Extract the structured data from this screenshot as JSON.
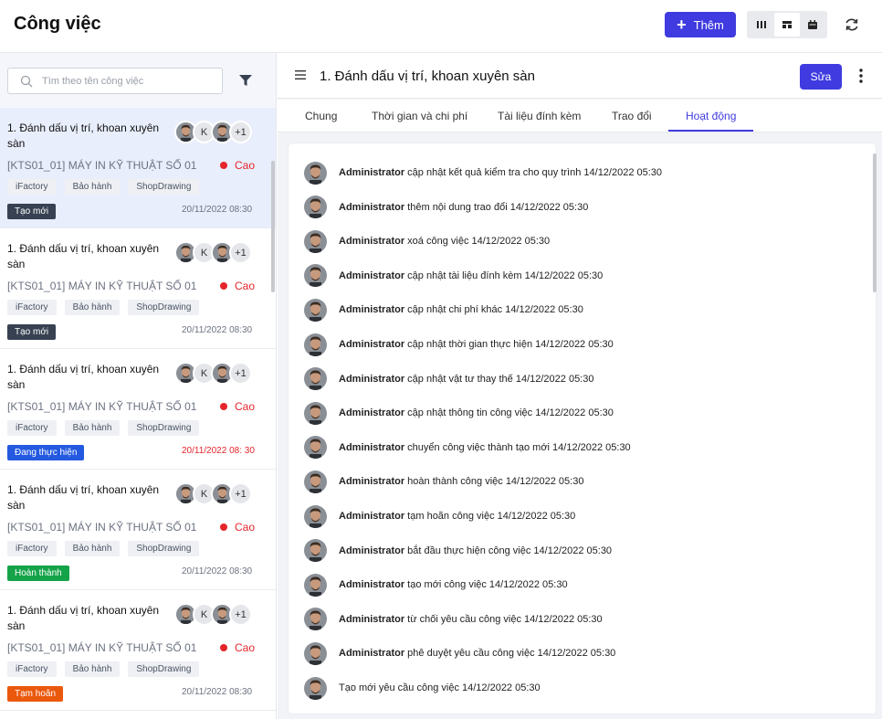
{
  "header": {
    "title": "Công việc",
    "add_label": "Thêm",
    "accent": "#3f3be0"
  },
  "search": {
    "placeholder": "Tìm theo tên công việc"
  },
  "cards": [
    {
      "title": "1. Đánh dấu vị trí, khoan xuyên sàn",
      "k": "K",
      "more": "+1",
      "code": "[KTS01_01] MÁY IN KỸ THUẬT SỐ 01",
      "priority": "Cao",
      "tags": [
        "iFactory",
        "Bảo hành",
        "ShopDrawing"
      ],
      "status": "Tạo mới",
      "status_color": "#374151",
      "date": "20/11/2022 08:30",
      "selected": true
    },
    {
      "title": "1. Đánh dấu vị trí, khoan xuyên sàn",
      "k": "K",
      "more": "+1",
      "code": "[KTS01_01] MÁY IN KỸ THUẬT SỐ 01",
      "priority": "Cao",
      "tags": [
        "iFactory",
        "Bảo hành",
        "ShopDrawing"
      ],
      "status": "Tạo mới",
      "status_color": "#374151",
      "date": "20/11/2022 08:30"
    },
    {
      "title": "1. Đánh dấu vị trí, khoan xuyên sàn",
      "k": "K",
      "more": "+1",
      "code": "[KTS01_01] MÁY IN KỸ THUẬT SỐ 01",
      "priority": "Cao",
      "tags": [
        "iFactory",
        "Bảo hành",
        "ShopDrawing"
      ],
      "status": "Đang thực hiện",
      "status_color": "#2459e0",
      "date": "20/11/2022 08: 30",
      "date_red": true
    },
    {
      "title": "1. Đánh dấu vị trí, khoan xuyên sàn",
      "k": "K",
      "more": "+1",
      "code": "[KTS01_01] MÁY IN KỸ THUẬT SỐ 01",
      "priority": "Cao",
      "tags": [
        "iFactory",
        "Bảo hành",
        "ShopDrawing"
      ],
      "status": "Hoàn thành",
      "status_color": "#15a34a",
      "date": "20/11/2022 08:30"
    },
    {
      "title": "1. Đánh dấu vị trí, khoan xuyên sàn",
      "k": "K",
      "more": "+1",
      "code": "[KTS01_01] MÁY IN KỸ THUẬT SỐ 01",
      "priority": "Cao",
      "tags": [
        "iFactory",
        "Bảo hành",
        "ShopDrawing"
      ],
      "status": "Tạm hoãn",
      "status_color": "#ea580c",
      "date": "20/11/2022 08:30"
    }
  ],
  "detail": {
    "title": "1. Đánh dấu vị trí, khoan xuyên sàn",
    "edit_label": "Sửa",
    "tabs": [
      "Chung",
      "Thời gian và chi phí",
      "Tài liệu đính kèm",
      "Trao đổi",
      "Hoạt động"
    ],
    "active_tab": "Hoạt động"
  },
  "activities": [
    {
      "user": "Administrator",
      "text": " cập nhật kết quả kiểm tra cho quy trình 14/12/2022 05:30"
    },
    {
      "user": "Administrator",
      "text": " thêm nội dung trao đổi 14/12/2022 05:30"
    },
    {
      "user": "Administrator",
      "text": " xoá công việc 14/12/2022 05:30"
    },
    {
      "user": "Administrator",
      "text": " cập nhật tài liệu đính kèm 14/12/2022 05:30"
    },
    {
      "user": "Administrator",
      "text": " cập nhật chi phí khác 14/12/2022 05:30"
    },
    {
      "user": "Administrator",
      "text": " cập nhật thời gian thực hiện 14/12/2022 05:30"
    },
    {
      "user": "Administrator",
      "text": " cập nhật vật tư thay thế 14/12/2022 05:30"
    },
    {
      "user": "Administrator",
      "text": " cập nhật thông tin công việc 14/12/2022 05:30"
    },
    {
      "user": "Administrator",
      "text": " chuyển công việc thành tạo mới 14/12/2022 05:30"
    },
    {
      "user": "Administrator",
      "text": " hoàn thành công việc 14/12/2022 05:30"
    },
    {
      "user": "Administrator",
      "text": " tạm hoãn công việc 14/12/2022 05:30"
    },
    {
      "user": "Administrator",
      "text": " bắt đầu thực hiện công việc 14/12/2022 05:30"
    },
    {
      "user": "Administrator",
      "text": " tạo mới công việc 14/12/2022 05:30"
    },
    {
      "user": "Administrator",
      "text": " từ chối yêu cầu công việc 14/12/2022 05:30"
    },
    {
      "user": "Administrator",
      "text": " phê duyệt yêu cầu công việc 14/12/2022 05:30"
    },
    {
      "user": "",
      "text": "Tạo mới yêu cầu công việc 14/12/2022 05:30"
    }
  ]
}
